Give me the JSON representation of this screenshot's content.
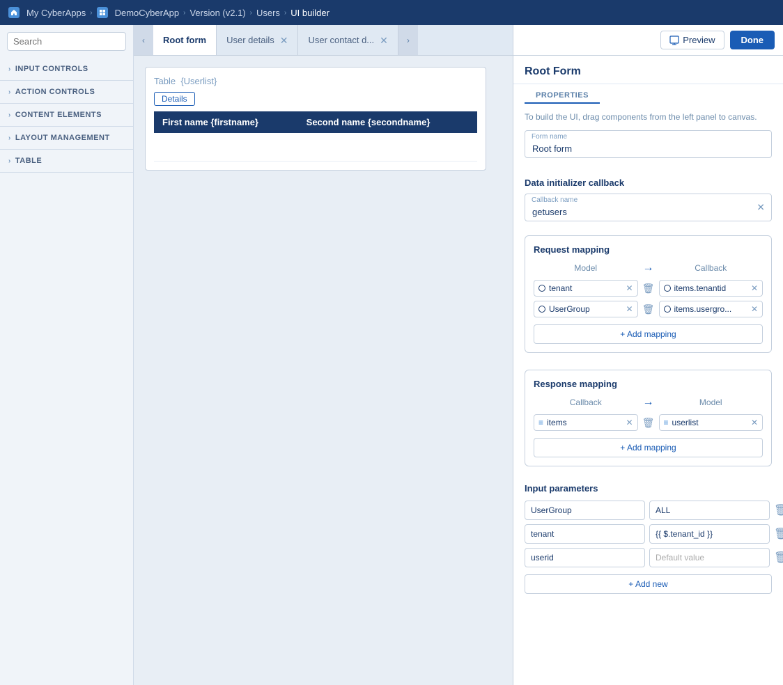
{
  "topnav": {
    "home": "My CyberApps",
    "app": "DemoCyberApp",
    "version": "Version (v2.1)",
    "users": "Users",
    "builder": "UI builder"
  },
  "sidebar": {
    "search_placeholder": "Search",
    "sections": [
      {
        "label": "INPUT CONTROLS"
      },
      {
        "label": "ACTION CONTROLS"
      },
      {
        "label": "CONTENT ELEMENTS"
      },
      {
        "label": "LAYOUT MANAGEMENT"
      },
      {
        "label": "TABLE"
      }
    ]
  },
  "tabs": [
    {
      "label": "Root form",
      "active": true,
      "closeable": false
    },
    {
      "label": "User details",
      "active": false,
      "closeable": true
    },
    {
      "label": "User contact d...",
      "active": false,
      "closeable": true
    }
  ],
  "toolbar": {
    "preview_label": "Preview",
    "done_label": "Done"
  },
  "canvas": {
    "table_title": "Table",
    "table_binding": "{Userlist}",
    "details_btn": "Details",
    "col1": "First name {firstname}",
    "col2": "Second name {secondname}"
  },
  "properties": {
    "panel_title": "Root Form",
    "section_label": "PROPERTIES",
    "description": "To build the UI, drag components from the left panel to canvas.",
    "form_name_label": "Form name",
    "form_name_value": "Root form",
    "callback_section_title": "Data initializer callback",
    "callback_name_label": "Callback name",
    "callback_name_value": "getusers",
    "request_mapping": {
      "title": "Request mapping",
      "model_label": "Model",
      "callback_label": "Callback",
      "rows": [
        {
          "model": "tenant",
          "callback": "items.tenantid"
        },
        {
          "model": "UserGroup",
          "callback": "items.usergro..."
        }
      ],
      "add_btn": "+ Add mapping"
    },
    "response_mapping": {
      "title": "Response mapping",
      "callback_label": "Callback",
      "model_label": "Model",
      "rows": [
        {
          "callback": "items",
          "model": "userlist"
        }
      ],
      "add_btn": "+ Add mapping"
    },
    "input_parameters": {
      "title": "Input parameters",
      "rows": [
        {
          "key": "UserGroup",
          "value": "ALL"
        },
        {
          "key": "tenant",
          "value": "{{ $.tenant_id }}"
        },
        {
          "key": "userid",
          "value": "Default value"
        }
      ],
      "add_btn": "+ Add new"
    }
  }
}
